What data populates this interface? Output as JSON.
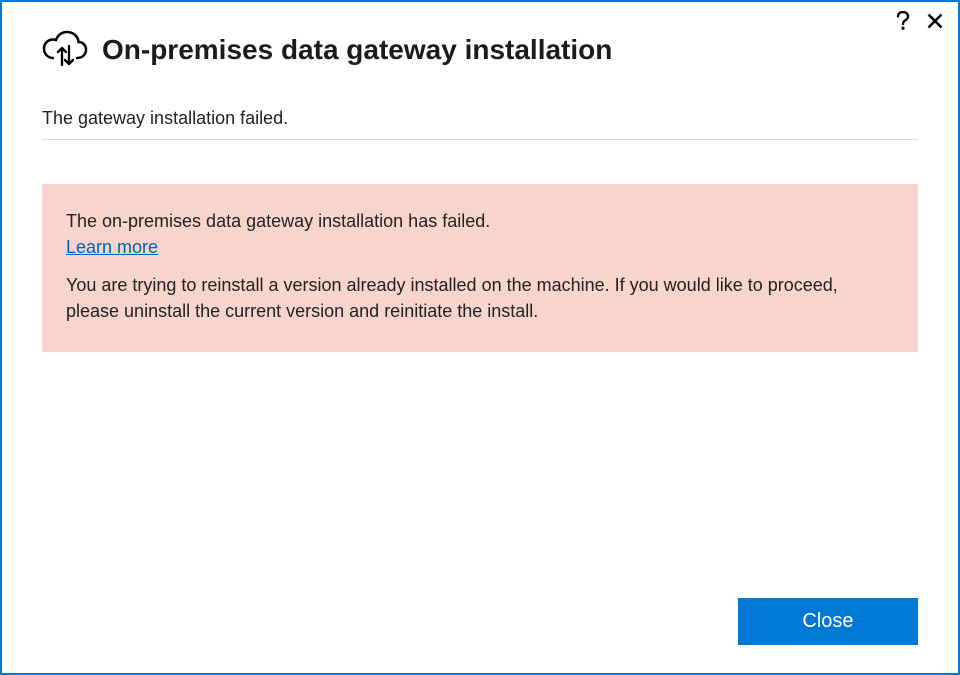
{
  "header": {
    "title": "On-premises data gateway installation"
  },
  "status": {
    "text": "The gateway installation failed."
  },
  "error": {
    "title": "The on-premises data gateway installation has failed.",
    "learn_more": "Learn more",
    "detail": "You are trying to reinstall a version already installed on the machine. If you would like to proceed, please uninstall the current version and reinitiate the install."
  },
  "footer": {
    "close_label": "Close"
  }
}
